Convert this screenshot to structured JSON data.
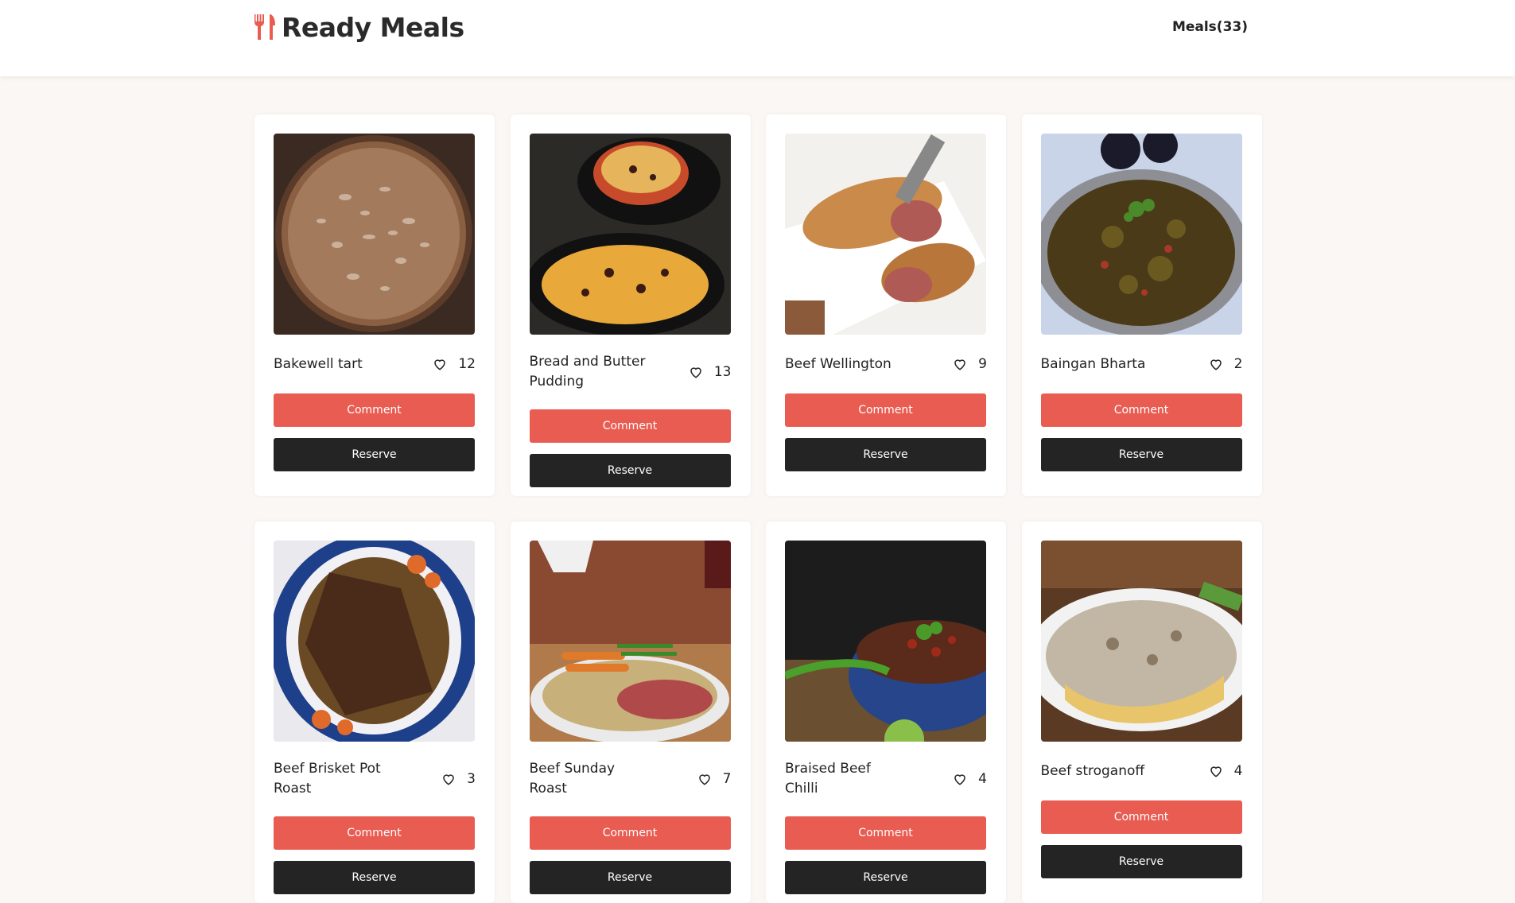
{
  "header": {
    "brand": "Ready Meals",
    "logo_icon": "fork-knife-icon",
    "meals_count": "Meals(33)",
    "accent_color": "#e85c52"
  },
  "buttons": {
    "comment": "Comment",
    "reserve": "Reserve"
  },
  "meals": [
    {
      "name": "Bakewell tart",
      "likes": "12",
      "image": "almond-tart-photo"
    },
    {
      "name": "Bread and Butter Pudding",
      "likes": "13",
      "image": "bread-pudding-photo"
    },
    {
      "name": "Beef Wellington",
      "likes": "9",
      "image": "beef-wellington-photo"
    },
    {
      "name": "Baingan Bharta",
      "likes": "2",
      "image": "eggplant-curry-photo"
    },
    {
      "name": "Beef Brisket Pot Roast",
      "likes": "3",
      "image": "brisket-photo"
    },
    {
      "name": "Beef Sunday Roast",
      "likes": "7",
      "image": "sunday-roast-photo"
    },
    {
      "name": "Braised Beef Chilli",
      "likes": "4",
      "image": "beef-chilli-photo"
    },
    {
      "name": "Beef stroganoff",
      "likes": "4",
      "image": "stroganoff-photo"
    }
  ]
}
